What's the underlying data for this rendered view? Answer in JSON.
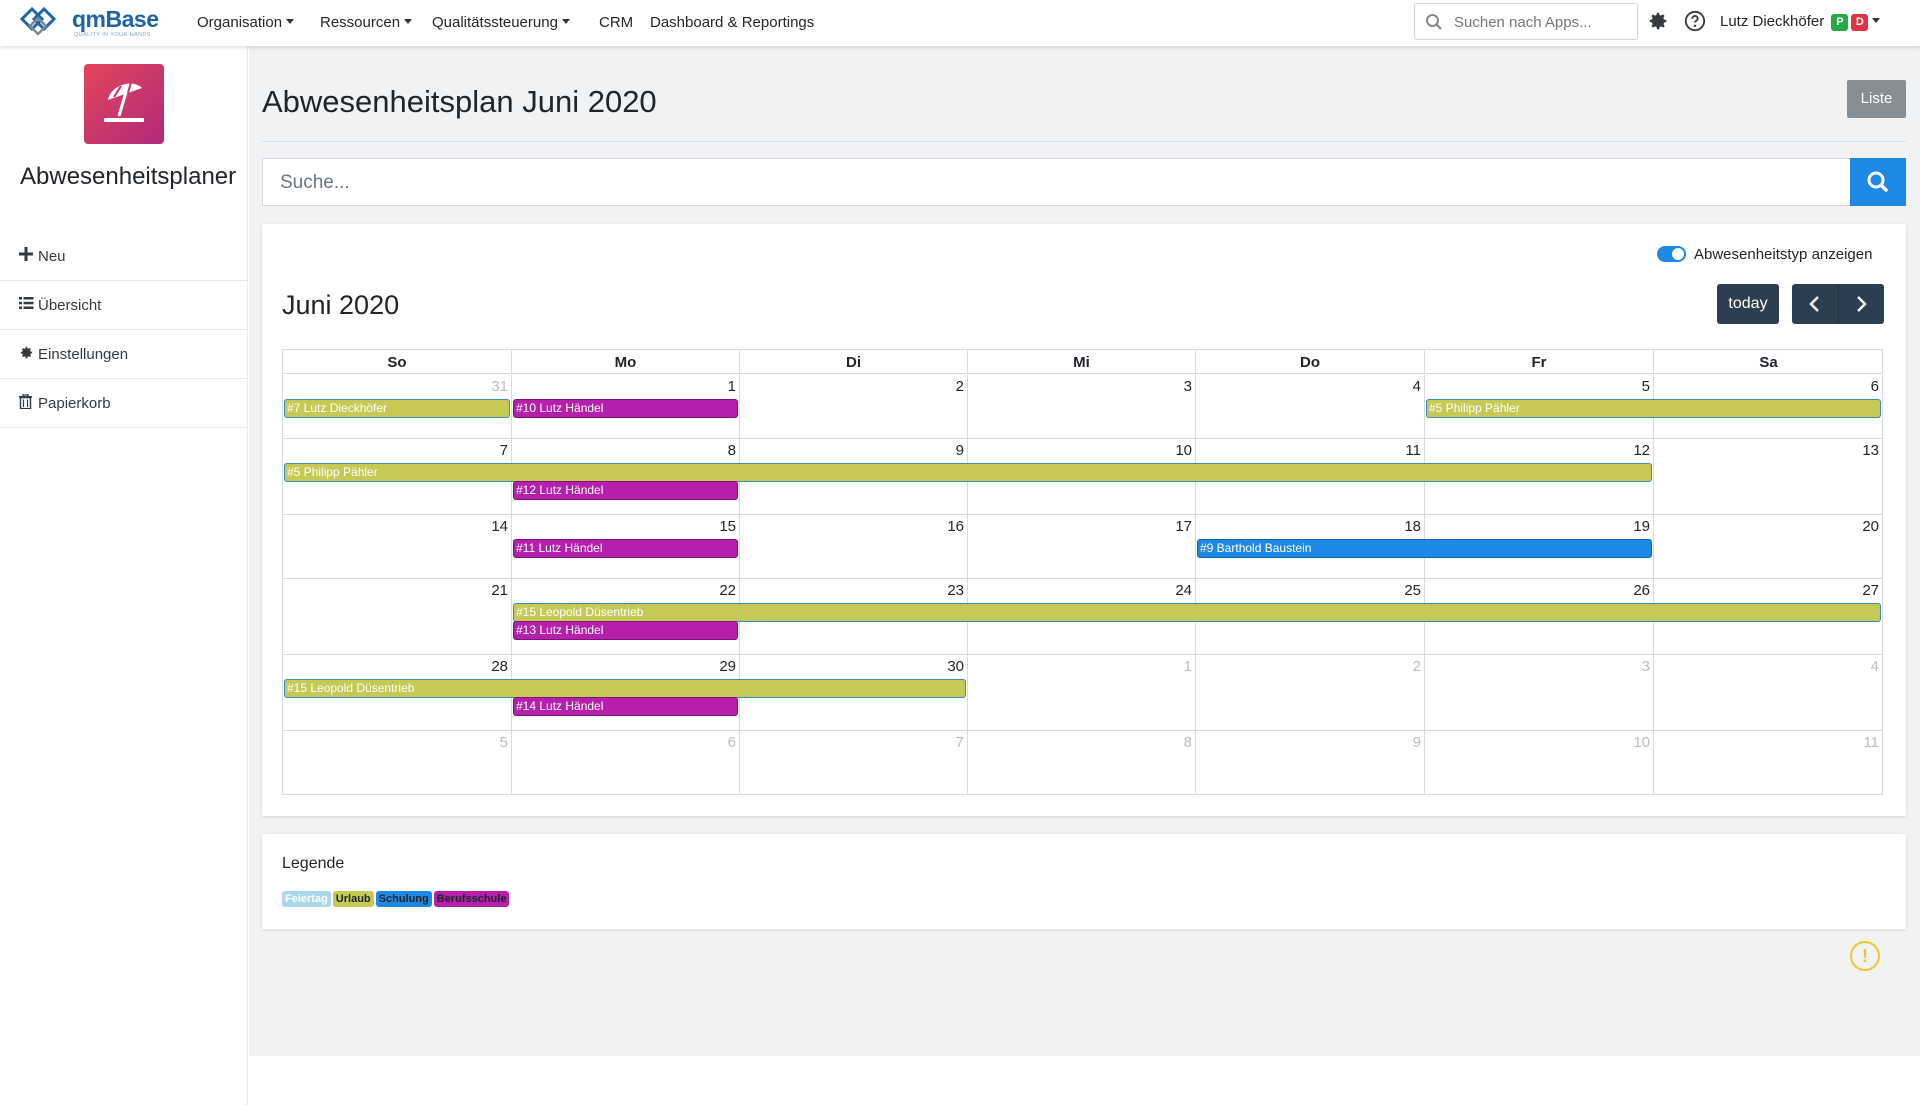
{
  "app": {
    "logo_word": "qmBase",
    "logo_tagline": "QUALITY IN YOUR HANDS",
    "nav": [
      {
        "label": "Organisation",
        "dropdown": true
      },
      {
        "label": "Ressourcen",
        "dropdown": true
      },
      {
        "label": "Qualitätssteuerung",
        "dropdown": true
      },
      {
        "label": "CRM",
        "dropdown": false
      },
      {
        "label": "Dashboard & Reportings",
        "dropdown": false
      }
    ],
    "search_placeholder": "Suchen nach Apps...",
    "user_name": "Lutz Dieckhöfer",
    "user_badges": [
      {
        "text": "P",
        "color": "#28a745"
      },
      {
        "text": "D",
        "color": "#dc3545"
      }
    ]
  },
  "sidebar": {
    "app_title": "Abwesenheitsplaner",
    "icon_name": "beach-umbrella-icon",
    "items": [
      {
        "label": "Neu",
        "icon": "plus-icon"
      },
      {
        "label": "Übersicht",
        "icon": "list-icon"
      },
      {
        "label": "Einstellungen",
        "icon": "gear-icon"
      },
      {
        "label": "Papierkorb",
        "icon": "trash-icon"
      }
    ]
  },
  "main": {
    "page_title": "Abwesenheitsplan Juni 2020",
    "liste_button": "Liste",
    "search_placeholder": "Suche...",
    "toggle_label": "Abwesenheitstyp anzeigen",
    "toggle_on": true,
    "calendar_title": "Juni 2020",
    "today_button": "today"
  },
  "calendar": {
    "day_names": [
      "So",
      "Mo",
      "Di",
      "Mi",
      "Do",
      "Fr",
      "Sa"
    ],
    "weeks": [
      {
        "days": [
          "31",
          "1",
          "2",
          "3",
          "4",
          "5",
          "6"
        ],
        "other": [
          true,
          false,
          false,
          false,
          false,
          false,
          false
        ],
        "events": [
          {
            "label": "#7 Lutz Dieckhöfer",
            "type": "urlaub",
            "start": 0,
            "span": 1,
            "lane": 0
          },
          {
            "label": "#10 Lutz Händel",
            "type": "beruf",
            "start": 1,
            "span": 1,
            "lane": 0
          },
          {
            "label": "#5 Philipp Pähler",
            "type": "urlaub",
            "start": 5,
            "span": 2,
            "lane": 0
          }
        ]
      },
      {
        "days": [
          "7",
          "8",
          "9",
          "10",
          "11",
          "12",
          "13"
        ],
        "other": [
          false,
          false,
          false,
          false,
          false,
          false,
          false
        ],
        "events": [
          {
            "label": "#5 Philipp Pähler",
            "type": "urlaub",
            "start": 0,
            "span": 6,
            "lane": 0
          },
          {
            "label": "#12 Lutz Händel",
            "type": "beruf",
            "start": 1,
            "span": 1,
            "lane": 1
          }
        ]
      },
      {
        "days": [
          "14",
          "15",
          "16",
          "17",
          "18",
          "19",
          "20"
        ],
        "other": [
          false,
          false,
          false,
          false,
          false,
          false,
          false
        ],
        "events": [
          {
            "label": "#11 Lutz Händel",
            "type": "beruf",
            "start": 1,
            "span": 1,
            "lane": 0
          },
          {
            "label": "#9 Barthold Baustein",
            "type": "schulung",
            "start": 4,
            "span": 2,
            "lane": 0
          }
        ]
      },
      {
        "days": [
          "21",
          "22",
          "23",
          "24",
          "25",
          "26",
          "27"
        ],
        "other": [
          false,
          false,
          false,
          false,
          false,
          false,
          false
        ],
        "events": [
          {
            "label": "#15 Leopold Düsentrieb",
            "type": "urlaub",
            "start": 1,
            "span": 6,
            "lane": 0
          },
          {
            "label": "#13 Lutz Händel",
            "type": "beruf",
            "start": 1,
            "span": 1,
            "lane": 1
          }
        ]
      },
      {
        "days": [
          "28",
          "29",
          "30",
          "1",
          "2",
          "3",
          "4"
        ],
        "other": [
          false,
          false,
          false,
          true,
          true,
          true,
          true
        ],
        "events": [
          {
            "label": "#15 Leopold Düsentrieb",
            "type": "urlaub",
            "start": 0,
            "span": 3,
            "lane": 0
          },
          {
            "label": "#14 Lutz Händel",
            "type": "beruf",
            "start": 1,
            "span": 1,
            "lane": 1
          }
        ]
      },
      {
        "days": [
          "5",
          "6",
          "7",
          "8",
          "9",
          "10",
          "11"
        ],
        "other": [
          true,
          true,
          true,
          true,
          true,
          true,
          true
        ],
        "events": []
      }
    ]
  },
  "legend": {
    "title": "Legende",
    "items": [
      {
        "label": "Feiertag",
        "bg": "#a8d8ea",
        "fg": "#ffffff"
      },
      {
        "label": "Urlaub",
        "bg": "#c6c954",
        "fg": "#212529"
      },
      {
        "label": "Schulung",
        "bg": "#1e88e5",
        "fg": "#212529"
      },
      {
        "label": "Berufsschule",
        "bg": "#b51fac",
        "fg": "#212529"
      }
    ]
  },
  "colors": {
    "accent": "#1e88e5",
    "dark_button": "#2c3e50",
    "urlaub": "#c6c954",
    "berufsschule": "#b51fac",
    "schulung": "#1e88e5",
    "warning": "#f2c230"
  }
}
